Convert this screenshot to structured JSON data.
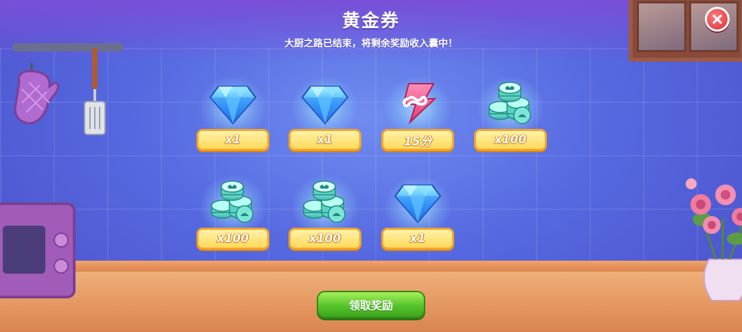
{
  "header": {
    "title": "黄金券",
    "subtitle": "大厨之路已结束，将剩余奖励收入囊中！"
  },
  "close_button": {
    "icon": "close-icon"
  },
  "rewards": [
    {
      "icon": "diamond-icon",
      "amount": "x1"
    },
    {
      "icon": "diamond-icon",
      "amount": "x1"
    },
    {
      "icon": "infinite-energy-icon",
      "amount": "15分"
    },
    {
      "icon": "coin-stack-icon",
      "amount": "x100"
    },
    {
      "icon": "coin-stack-icon",
      "amount": "x100"
    },
    {
      "icon": "coin-stack-icon",
      "amount": "x100"
    },
    {
      "icon": "diamond-icon",
      "amount": "x1"
    }
  ],
  "claim_button": {
    "label": "领取奖励"
  },
  "colors": {
    "background": "#5669e0",
    "badge": "#ffd95a",
    "badge_border": "#f3a52c",
    "claim_button": "#55c42a",
    "close_button": "#d9323f"
  }
}
